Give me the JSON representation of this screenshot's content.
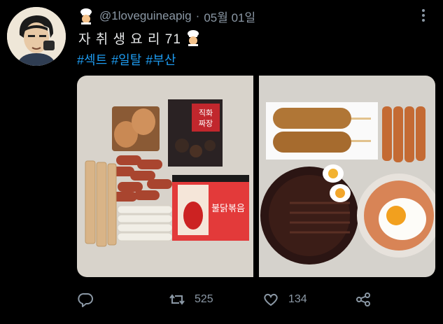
{
  "tweet": {
    "handle": "@1loveguineapig",
    "separator": "·",
    "date": "05월 01일",
    "text": "자 취 생 요 리 71",
    "hashtags": [
      "#섹트",
      "#일탈",
      "#부산"
    ]
  },
  "packages": {
    "jjajang_text": "직화\n짜장",
    "buldak_text": "불닭볶음"
  },
  "actions": {
    "reply": {
      "icon": "reply-icon"
    },
    "retweet": {
      "icon": "retweet-icon",
      "count": "525"
    },
    "like": {
      "icon": "heart-icon",
      "count": "134"
    },
    "share": {
      "icon": "share-icon"
    }
  },
  "colors": {
    "background": "#000000",
    "text": "#e7e9ea",
    "muted": "#8b98a5",
    "link": "#1d9bf0"
  }
}
